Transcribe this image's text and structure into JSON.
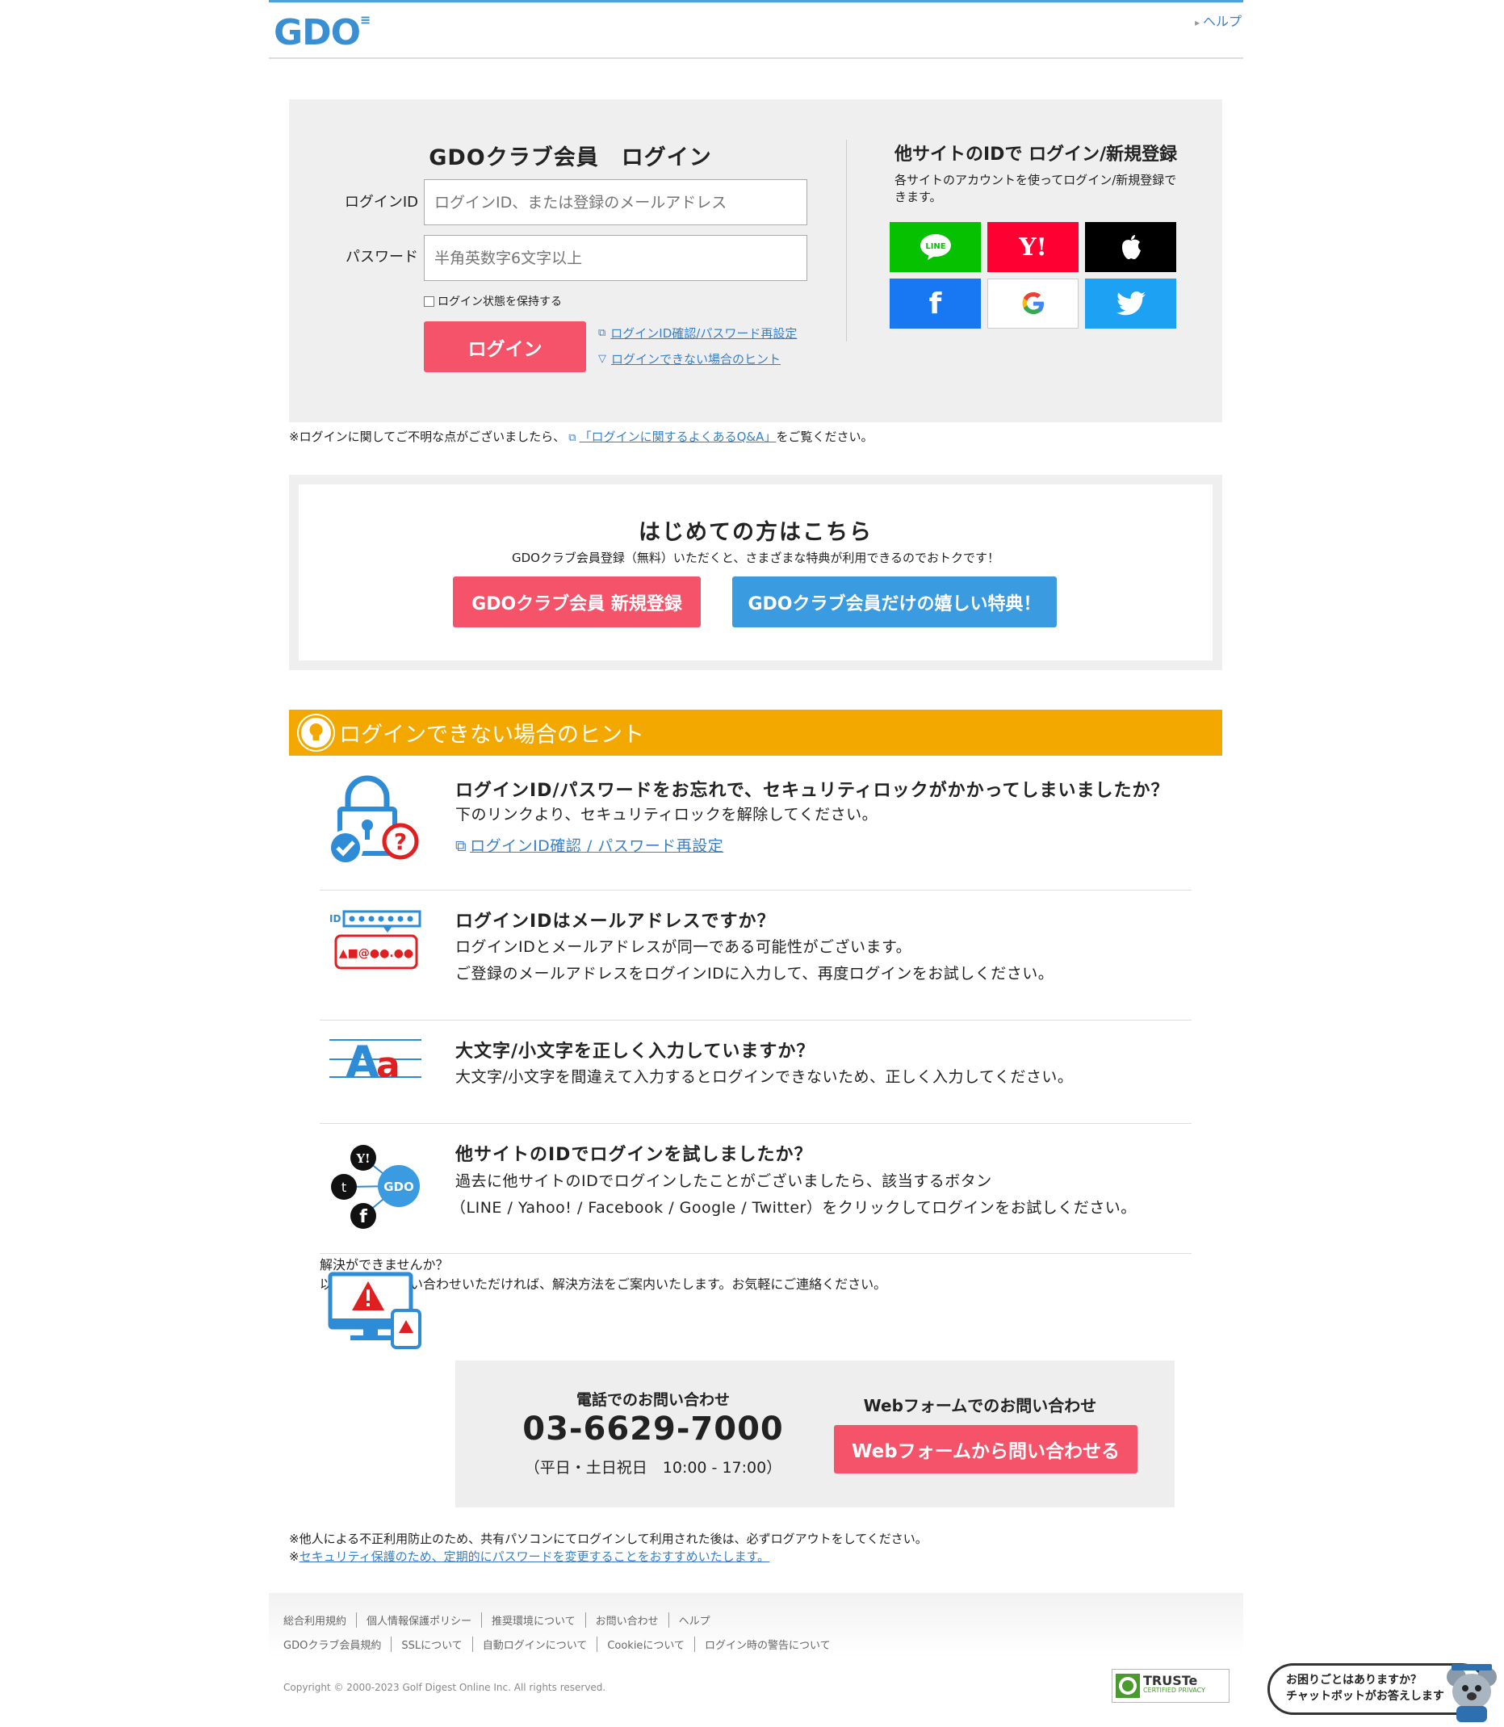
{
  "header": {
    "logo": "GDO",
    "help_link": "ヘルプ"
  },
  "login": {
    "title": "GDOクラブ会員　ログイン",
    "id_label": "ログインID",
    "id_placeholder": "ログインID、または登録のメールアドレス",
    "pw_label": "パスワード",
    "pw_placeholder": "半角英数字6文字以上",
    "keep_label": "ログイン状態を保持する",
    "button": "ログイン",
    "link_reset": "ログインID確認/パスワード再設定",
    "link_hint": "ログインできない場合のヒント"
  },
  "social": {
    "title": "他サイトのIDで ログイン/新規登録",
    "desc": "各サイトのアカウントを使ってログイン/新規登録できます。",
    "line_label": "LINE",
    "yahoo_label": "Y!",
    "colors": {
      "line": "#06c100",
      "yahoo": "#ff0033",
      "apple": "#000000",
      "facebook": "#1877f2",
      "google": "#ffffff",
      "twitter": "#1da1f2"
    }
  },
  "notice": {
    "prefix": "※ログインに関してご不明な点がございましたら、",
    "link": "「ログインに関するよくあるQ&A」",
    "suffix": "をご覧ください。"
  },
  "first_time": {
    "title": "はじめての方はこちら",
    "desc": "GDOクラブ会員登録（無料）いただくと、さまざまな特典が利用できるのでおトクです！",
    "register_button": "GDOクラブ会員 新規登録",
    "benefit_button": "GDOクラブ会員だけの嬉しい特典！"
  },
  "hints": {
    "heading": "ログインできない場合のヒント",
    "items": [
      {
        "title": "ログインID/パスワードをお忘れで、セキュリティロックがかかってしまいましたか？",
        "desc1": "下のリンクより、セキュリティロックを解除してください。",
        "link": "ログインID確認 / パスワード再設定"
      },
      {
        "title": "ログインIDはメールアドレスですか？",
        "desc1": "ログインIDとメールアドレスが同一である可能性がございます。",
        "desc2": "ご登録のメールアドレスをログインIDに入力して、再度ログインをお試しください。"
      },
      {
        "title": "大文字/小文字を正しく入力していますか？",
        "desc1": "大文字/小文字を間違えて入力するとログインできないため、正しく入力してください。"
      },
      {
        "title": "他サイトのIDでログインを試しましたか？",
        "desc1": "過去に他サイトのIDでログインしたことがございましたら、該当するボタン",
        "desc2": "（LINE / Yahoo! / Facebook / Google / Twitter）をクリックしてログインをお試しください。"
      },
      {
        "title": "解決ができませんか？",
        "desc1": "以下窓口へお問い合わせいただければ、解決方法をご案内いたします。お気軽にご連絡ください。"
      }
    ]
  },
  "contact": {
    "phone_heading": "電話でのお問い合わせ",
    "phone": "03-6629-7000",
    "hours": "（平日・土日祝日　10:00 - 17:00）",
    "web_heading": "Webフォームでのお問い合わせ",
    "web_button": "Webフォームから問い合わせる"
  },
  "notes": {
    "note1": "※他人による不正利用防止のため、共有パソコンにてログインして利用された後は、必ずログアウトをしてください。",
    "note2_prefix": "※",
    "note2_link": "セキュリティ保護のため、定期的にパスワードを変更することをおすすめいたします。"
  },
  "footer": {
    "row1": [
      "総合利用規約",
      "個人情報保護ポリシー",
      "推奨環境について",
      "お問い合わせ",
      "ヘルプ"
    ],
    "row2": [
      "GDOクラブ会員規約",
      "SSLについて",
      "自動ログインについて",
      "Cookieについて",
      "ログイン時の警告について"
    ],
    "copyright": "Copyright © 2000-2023 Golf Digest Online Inc. All rights reserved.",
    "truste": "TRUSTe",
    "truste_sub": "CERTIFIED PRIVACY"
  },
  "chatbot": {
    "line1": "お困りごとはありますか？",
    "line2": "チャットボットがお答えします"
  }
}
